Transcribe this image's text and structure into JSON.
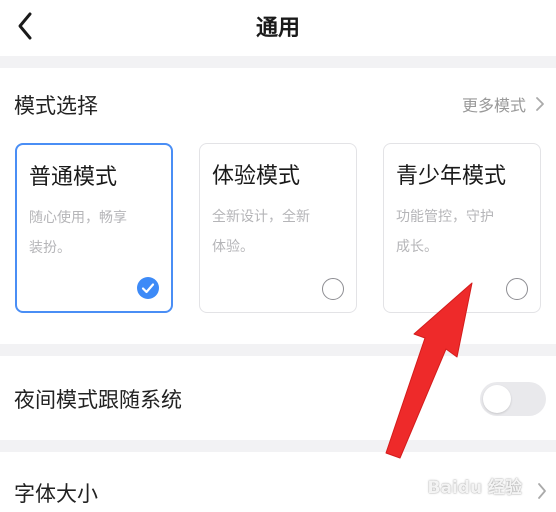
{
  "header": {
    "title": "通用",
    "back_icon": "chevron-left-icon"
  },
  "mode_section": {
    "title": "模式选择",
    "more_label": "更多模式",
    "more_icon": "chevron-right-icon",
    "cards": [
      {
        "title": "普通模式",
        "desc_line1": "随心使用，畅享",
        "desc_line2": "装扮。",
        "selected": true
      },
      {
        "title": "体验模式",
        "desc_line1": "全新设计，全新",
        "desc_line2": "体验。",
        "selected": false
      },
      {
        "title": "青少年模式",
        "desc_line1": "功能管控，守护",
        "desc_line2": "成长。",
        "selected": false
      }
    ]
  },
  "night_mode": {
    "label": "夜间模式跟随系统",
    "enabled": false
  },
  "font_size": {
    "label": "字体大小"
  },
  "watermark": {
    "text": "Baidu 经验"
  },
  "colors": {
    "accent": "#3d8af7",
    "annotation": "#ee2a2a",
    "background": "#f2f2f4"
  }
}
